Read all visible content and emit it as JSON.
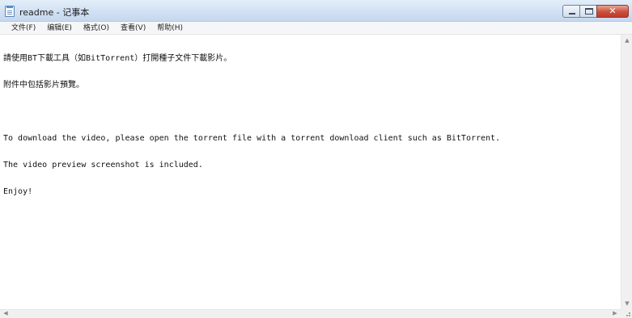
{
  "window": {
    "title": "readme - 记事本",
    "app_icon": "notepad-icon",
    "caption": {
      "minimize_icon": "minimize-icon",
      "maximize_icon": "maximize-icon",
      "close_icon": "close-icon",
      "close_glyph": "✕"
    }
  },
  "menu": {
    "items": [
      "文件(F)",
      "编辑(E)",
      "格式(O)",
      "查看(V)",
      "帮助(H)"
    ]
  },
  "document": {
    "lines": [
      "請使用BT下載工具（如BitTorrent）打開種子文件下載影片。",
      "附件中包括影片預覽。",
      "",
      "To download the video, please open the torrent file with a torrent download client such as BitTorrent.",
      "The video preview screenshot is included.",
      "Enjoy!"
    ]
  },
  "scrollbars": {
    "up_glyph": "▲",
    "down_glyph": "▼",
    "left_glyph": "◀",
    "right_glyph": "▶"
  },
  "colors": {
    "titlebar": "#d4e3f4",
    "close_button": "#cc4e3c",
    "menubar": "#f5f6f7"
  }
}
